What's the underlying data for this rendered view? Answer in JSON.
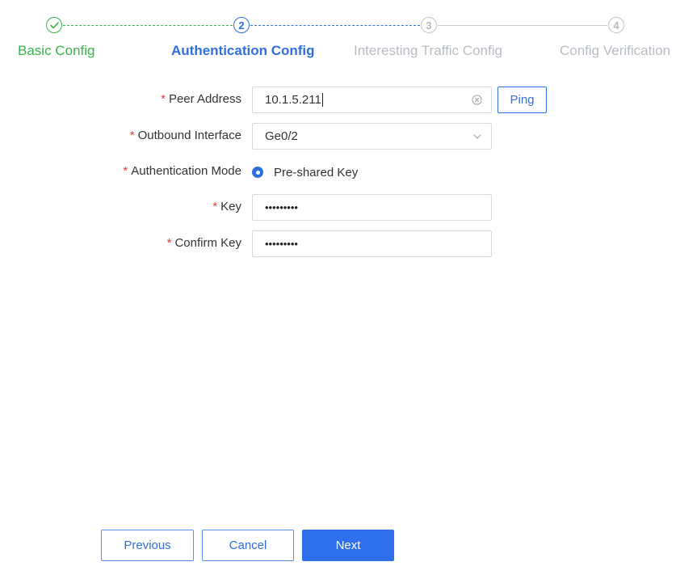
{
  "colors": {
    "done": "#37b34a",
    "active": "#2e6fe0",
    "inactive": "#b7bcc4",
    "required": "#e33b3b",
    "primary_button": "#2f6fec"
  },
  "stepper": {
    "steps": [
      {
        "number": "",
        "icon": "check-icon",
        "title": "Basic Config",
        "state": "done"
      },
      {
        "number": "2",
        "title": "Authentication Config",
        "state": "active"
      },
      {
        "number": "3",
        "title": "Interesting Traffic Config",
        "state": "todo"
      },
      {
        "number": "4",
        "title": "Config Verification",
        "state": "todo"
      }
    ]
  },
  "form": {
    "required_mark": "*",
    "peer_address": {
      "label": "Peer Address",
      "value": "10.1.5.211",
      "clear_icon": "close-circle-icon",
      "ping_label": "Ping"
    },
    "outbound_interface": {
      "label": "Outbound Interface",
      "value": "Ge0/2",
      "icon": "chevron-down-icon"
    },
    "authentication_mode": {
      "label": "Authentication Mode",
      "option": "Pre-shared Key",
      "selected": true
    },
    "key": {
      "label": "Key",
      "masked_value": "•••••••••"
    },
    "confirm_key": {
      "label": "Confirm Key",
      "masked_value": "•••••••••"
    }
  },
  "footer": {
    "previous_label": "Previous",
    "cancel_label": "Cancel",
    "next_label": "Next"
  }
}
